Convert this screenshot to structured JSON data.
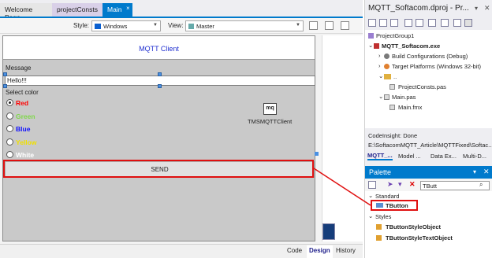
{
  "tabs": [
    "Welcome Page",
    "projectConsts",
    "Main"
  ],
  "tab_close": "×",
  "toolbar": {
    "style_label": "Style:",
    "style_value": "Windows",
    "view_label": "View:",
    "view_value": "Master"
  },
  "form": {
    "title": "MQTT Client",
    "message_label": "Message",
    "message_value": "Hello!!!",
    "select_label": "Select color",
    "radios": [
      {
        "label": "Red",
        "color": "#ff0000"
      },
      {
        "label": "Green",
        "color": "#7fd84a"
      },
      {
        "label": "Blue",
        "color": "#1010ff"
      },
      {
        "label": "Yellow",
        "color": "#f0e000"
      },
      {
        "label": "White",
        "color": "#ffffff"
      }
    ],
    "selected_radio": "Red",
    "component_icon": "mq",
    "component_label": "TMSMQTTClient",
    "send_label": "SEND"
  },
  "bottom_tabs": [
    "Code",
    "Design",
    "History"
  ],
  "project": {
    "title": "MQTT_Softacom.dproj - Pr...",
    "tree": [
      "ProjectGroup1",
      "MQTT_Softacom.exe",
      "Build Configurations (Debug)",
      "Target Platforms (Windows 32-bit)",
      "..",
      "ProjectConsts.pas",
      "Main.pas",
      "Main.fmx"
    ],
    "codeinsight": "CodeInsight: Done",
    "path": "E:\\SoftacomMQTT_Article\\MQTTFixed\\Softac...",
    "pane_tabs": [
      "MQTT_...",
      "Model ...",
      "Data Ex...",
      "Multi-D..."
    ]
  },
  "palette": {
    "title": "Palette",
    "search": "TButt",
    "sections": [
      "Standard",
      "Styles"
    ],
    "items": [
      "TButton",
      "TButtonStyleObject",
      "TButtonStyleTextObject"
    ]
  },
  "colors": {
    "accent": "#007acc",
    "highlight": "#e01010",
    "form_title": "#1f2fd0"
  }
}
